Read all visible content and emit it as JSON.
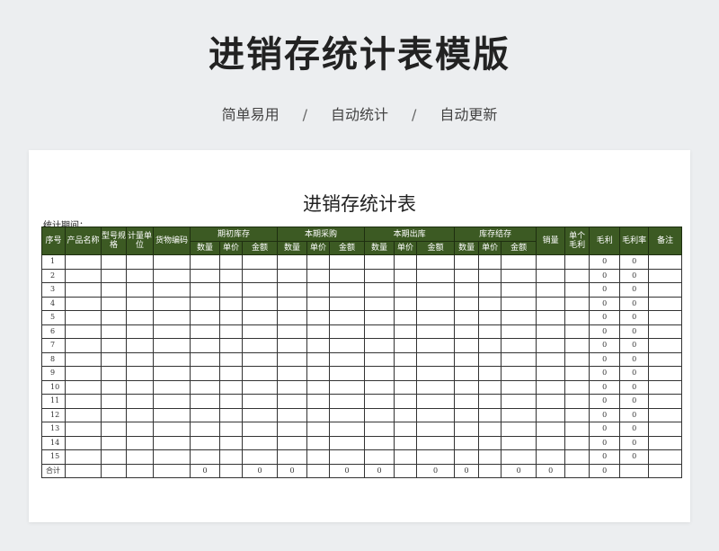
{
  "page": {
    "title": "进销存统计表模版",
    "tags": [
      "简单易用",
      "自动统计",
      "自动更新"
    ],
    "separator": "/"
  },
  "sheet": {
    "title": "进销存统计表",
    "period_label": "统计期间："
  },
  "table": {
    "headers": {
      "seq": "序号",
      "product": "产品名称",
      "model": "型号规格",
      "unit": "计量单位",
      "code": "货物编码",
      "groups": [
        "期初库存",
        "本期采购",
        "本期出库",
        "库存结存"
      ],
      "subcols": [
        "数量",
        "单价",
        "金额"
      ],
      "sales": "销量",
      "unit_margin": "单个毛利",
      "margin": "毛利",
      "margin_rate": "毛利率",
      "remark": "备注"
    },
    "rows": [
      {
        "no": "1",
        "margin": "0",
        "rate": "0"
      },
      {
        "no": "2",
        "margin": "0",
        "rate": "0"
      },
      {
        "no": "3",
        "margin": "0",
        "rate": "0"
      },
      {
        "no": "4",
        "margin": "0",
        "rate": "0"
      },
      {
        "no": "5",
        "margin": "0",
        "rate": "0"
      },
      {
        "no": "6",
        "margin": "0",
        "rate": "0"
      },
      {
        "no": "7",
        "margin": "0",
        "rate": "0"
      },
      {
        "no": "8",
        "margin": "0",
        "rate": "0"
      },
      {
        "no": "9",
        "margin": "0",
        "rate": "0"
      },
      {
        "no": "10",
        "margin": "0",
        "rate": "0"
      },
      {
        "no": "11",
        "margin": "0",
        "rate": "0"
      },
      {
        "no": "12",
        "margin": "0",
        "rate": "0"
      },
      {
        "no": "13",
        "margin": "0",
        "rate": "0"
      },
      {
        "no": "14",
        "margin": "0",
        "rate": "0"
      },
      {
        "no": "15",
        "margin": "0",
        "rate": "0"
      }
    ],
    "total": {
      "label": "合计",
      "open_qty": "0",
      "open_amount": "0",
      "purchase_qty": "0",
      "purchase_amount": "0",
      "out_qty": "0",
      "out_amount": "0",
      "stock_qty": "0",
      "stock_amount": "0",
      "sales": "0",
      "margin": "0"
    }
  },
  "colors": {
    "header_bg": "#3c5a23",
    "page_bg": "#eceef0"
  }
}
